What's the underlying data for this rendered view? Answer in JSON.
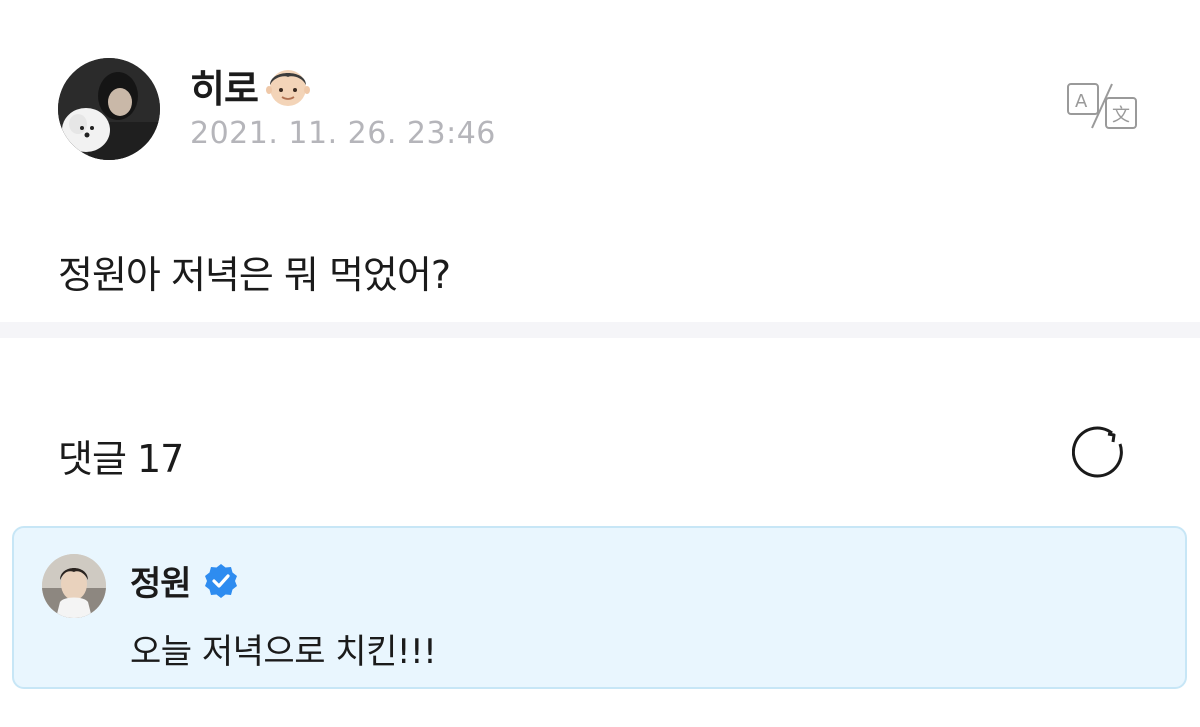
{
  "post": {
    "author": {
      "name": "히로",
      "emoji_icon": "boy-emoji-icon",
      "avatar_icon": "avatar-with-white-dog"
    },
    "date": "2021. 11. 26. 23:46",
    "translate_icon": "translate-icon",
    "body": "정원아 저녁은 뭐 먹었어?"
  },
  "comments": {
    "title": "댓글 17",
    "refresh_icon": "refresh-icon",
    "items": [
      {
        "author": "정원",
        "verified_icon": "verified-badge-icon",
        "text": "오늘 저녁으로 치킨!!!",
        "highlight_color": "#e9f6fe"
      }
    ]
  },
  "colors": {
    "date_gray": "#b5b5ba",
    "verified_blue": "#2e8cf0",
    "comment_bg": "#e9f6fe",
    "comment_border": "#c7e6f6"
  }
}
